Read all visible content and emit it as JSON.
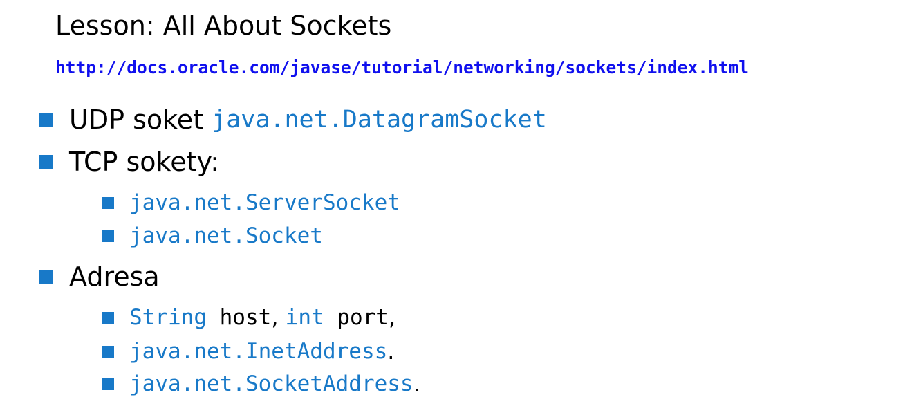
{
  "title": "Lesson: All About Sockets",
  "url": "http://docs.oracle.com/javase/tutorial/networking/sockets/index.html",
  "items": {
    "udp": {
      "text": "UDP soket ",
      "code": "java.net.DatagramSocket"
    },
    "tcp": {
      "text": "TCP sokety:",
      "subitems": {
        "server_socket": "java.net.ServerSocket",
        "socket": "java.net.Socket"
      }
    },
    "address": {
      "text": "Adresa",
      "subitems": {
        "host_port": {
          "type1": "String",
          "name1": " host",
          "sep1": ", ",
          "type2": "int",
          "name2": " port",
          "sep2": ","
        },
        "inet": {
          "code": "java.net.InetAddress",
          "suffix": "."
        },
        "socket_address": {
          "code": "java.net.SocketAddress",
          "suffix": "."
        }
      }
    }
  },
  "colors": {
    "bullet": "#1879c8",
    "code": "#1879c8",
    "link": "#1010ee"
  }
}
